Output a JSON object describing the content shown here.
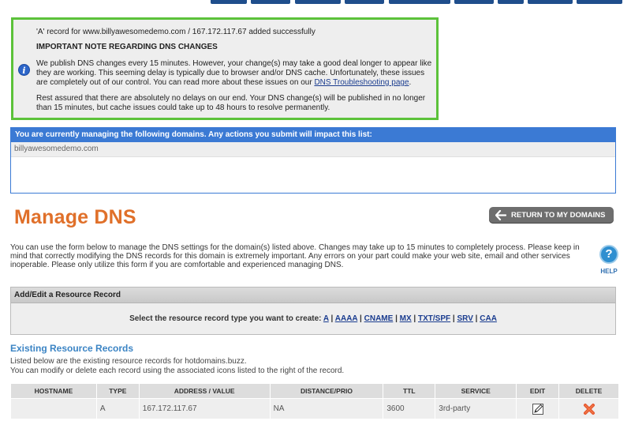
{
  "colors": {
    "notice_border": "#5cc23a",
    "panel_blue": "#3b7ad4",
    "title_orange": "#e0702a",
    "link_blue": "#1a3c8f",
    "delete_red": "#e5532b"
  },
  "notice": {
    "success": "'A' record for www.billyawesomedemo.com / 167.172.117.67 added successfully",
    "heading": "IMPORTANT NOTE REGARDING DNS CHANGES",
    "para1_text": "We publish DNS changes every 15 minutes. However, your change(s) may take a good deal longer to appear like they are working. This seeming delay is typically due to browser and/or DNS cache. Unfortunately, these issues are completely out of our control. You can read more about these issues on our ",
    "para1_link": "DNS Troubleshooting page",
    "para1_end": ".",
    "para2": "Rest assured that there are absolutely no delays on our end. Your DNS change(s) will be published in no longer than 15 minutes, but cache issues could take up to 48 hours to resolve permanently."
  },
  "managing": {
    "header": "You are currently managing the following domains. Any actions you submit will impact this list:",
    "domains": [
      "billyawesomedemo.com"
    ]
  },
  "page": {
    "title": "Manage DNS",
    "return_button": "RETURN TO MY DOMAINS",
    "intro": "You can use the form below to manage the DNS settings for the domain(s) listed above. Changes may take up to 15 minutes to completely process. Please keep in mind that correctly modifying the DNS records for this domain is extremely important. Any errors on your part could make your web site, email and other services inoperable. Please only utilize this form if you are comfortable and experienced managing DNS.",
    "help_label": "HELP"
  },
  "add_edit": {
    "header": "Add/Edit a Resource Record",
    "prompt": "Select the resource record type you want to create:",
    "types": [
      "A",
      "AAAA",
      "CNAME",
      "MX",
      "TXT/SPF",
      "SRV",
      "CAA"
    ]
  },
  "existing": {
    "title": "Existing Resource Records",
    "desc1": "Listed below are the existing resource records for hotdomains.buzz.",
    "desc2": "You can modify or delete each record using the associated icons listed to the right of the record."
  },
  "table": {
    "headers": [
      "HOSTNAME",
      "TYPE",
      "ADDRESS / VALUE",
      "DISTANCE/PRIO",
      "TTL",
      "SERVICE",
      "EDIT",
      "DELETE"
    ],
    "rows": [
      {
        "hostname": "",
        "type": "A",
        "value": "167.172.117.67",
        "prio": "NA",
        "ttl": "3600",
        "service": "3rd-party"
      }
    ]
  }
}
